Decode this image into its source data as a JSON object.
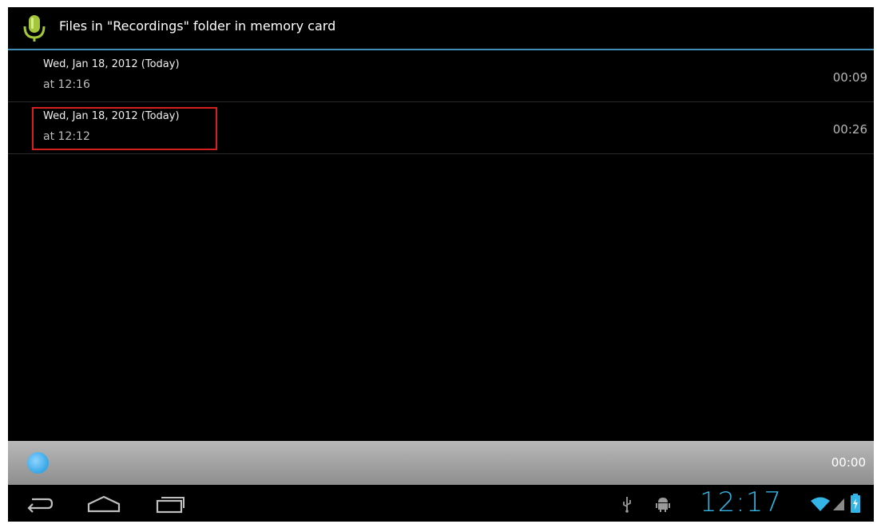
{
  "actionbar": {
    "title": "Files in \"Recordings\" folder in memory card",
    "icon": "microphone-icon"
  },
  "recordings": [
    {
      "date": "Wed, Jan 18, 2012 (Today)",
      "time": "at 12:16",
      "duration": "00:09"
    },
    {
      "date": "Wed, Jan 18, 2012 (Today)",
      "time": "at 12:12",
      "duration": "00:26"
    }
  ],
  "player": {
    "elapsed": "00:00"
  },
  "systembar": {
    "clock": "12:17",
    "icons": [
      "back-icon",
      "home-icon",
      "recent-apps-icon",
      "usb-icon",
      "android-debug-icon",
      "wifi-icon",
      "signal-icon",
      "battery-icon"
    ]
  },
  "colors": {
    "accent": "#33b5e5",
    "divider": "#3f8fb2",
    "highlight": "#d62020",
    "mic": "#a4c639"
  }
}
